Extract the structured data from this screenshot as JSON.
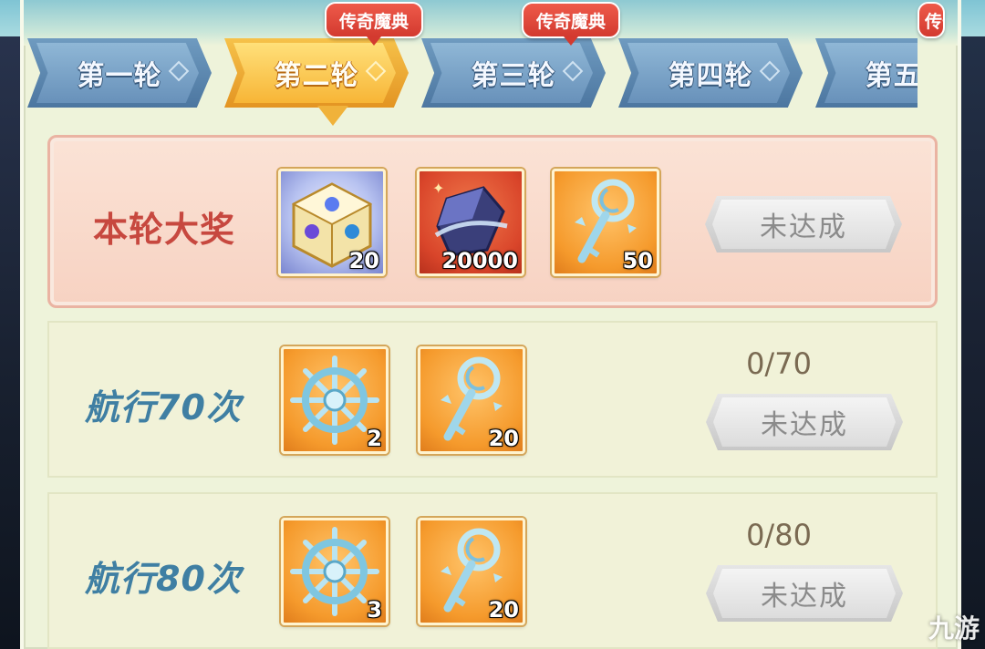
{
  "tabs": [
    {
      "label": "第一轮",
      "active": false
    },
    {
      "label": "第二轮",
      "active": true
    },
    {
      "label": "第三轮",
      "active": false
    },
    {
      "label": "第四轮",
      "active": false
    },
    {
      "label": "第五轮",
      "active": false
    }
  ],
  "badges": [
    "传奇魔典",
    "传奇魔典",
    "传奇魔典"
  ],
  "grand_prize": {
    "title": "本轮大奖",
    "items": [
      {
        "icon": "crystal-cube-icon",
        "qty": "20"
      },
      {
        "icon": "dark-crystal-icon",
        "qty": "20000"
      },
      {
        "icon": "moon-key-icon",
        "qty": "50"
      }
    ],
    "status": "未达成"
  },
  "milestones": [
    {
      "title": "航行70次",
      "progress": "0/70",
      "items": [
        {
          "icon": "ship-wheel-icon",
          "qty": "2"
        },
        {
          "icon": "moon-key-icon",
          "qty": "20"
        }
      ],
      "status": "未达成"
    },
    {
      "title": "航行80次",
      "progress": "0/80",
      "items": [
        {
          "icon": "ship-wheel-icon",
          "qty": "3"
        },
        {
          "icon": "moon-key-icon",
          "qty": "20"
        }
      ],
      "status": "未达成"
    }
  ],
  "watermark": "九游",
  "colors": {
    "active_tab": "#f7b536",
    "inactive_tab": "#6891ba",
    "grand_title": "#c7483f",
    "milestone_title": "#3f7fa3",
    "badge": "#d33a2f"
  }
}
